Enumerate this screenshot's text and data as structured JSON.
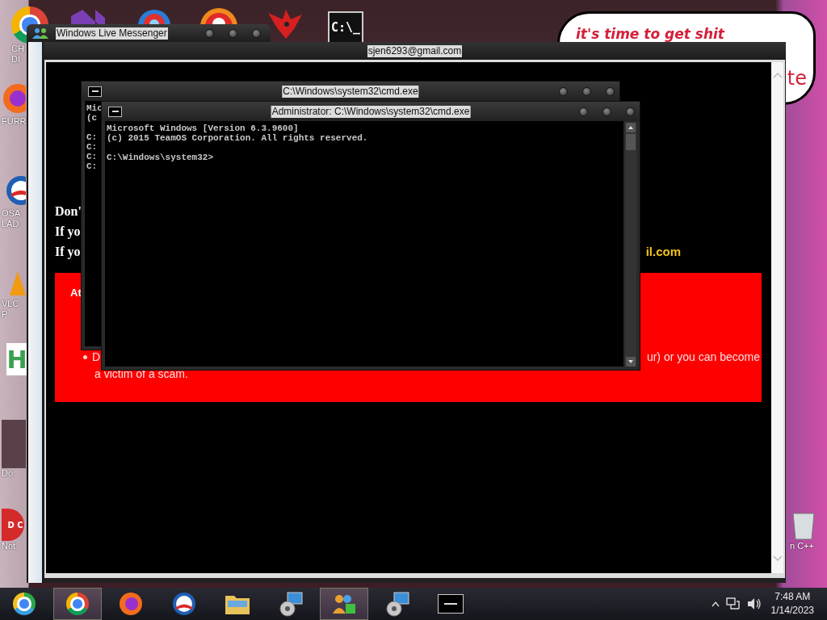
{
  "desktop": {
    "icons": [
      {
        "kind": "chrome",
        "label": [
          "CH",
          "DI"
        ]
      },
      {
        "kind": "ribbon"
      },
      {
        "kind": "ring"
      },
      {
        "kind": "disc"
      },
      {
        "kind": "bird"
      },
      {
        "kind": "terminal",
        "text": "C:\\_"
      },
      {
        "kind": "globe",
        "label": [
          "FURR"
        ]
      },
      {
        "kind": "sunrise",
        "label": [
          "OSA",
          "LAD"
        ]
      },
      {
        "kind": "cone",
        "label": [
          "VLC",
          "P"
        ]
      },
      {
        "kind": "letter",
        "text": "H"
      },
      {
        "kind": "photo",
        "label": [
          "Do"
        ]
      },
      {
        "kind": "badge",
        "text": "D C",
        "label": [
          "Not"
        ]
      },
      {
        "kind": "bin",
        "label": [
          "n C++"
        ]
      }
    ],
    "bubble": {
      "lines": [
        "it's time to get shit",
        "te"
      ]
    }
  },
  "messenger": {
    "title": "Windows Live Messenger",
    "account": "sjen6293@gmail.com",
    "lines": [
      {
        "left": "Don'"
      },
      {
        "left": "If yo"
      },
      {
        "left": "If yo",
        "right": "il.com"
      }
    ],
    "alert": {
      "heading": "At",
      "bullet_start": "D",
      "bullet_end": "ur) or you can become",
      "continuation": "a victim of a scam."
    }
  },
  "cmd_back": {
    "title": "C:\\Windows\\system32\\cmd.exe",
    "blocks": [
      [
        "Mic",
        "(c"
      ],
      [
        "C:",
        "C:",
        "C:",
        "C:"
      ]
    ]
  },
  "cmd_front": {
    "title": "Administrator: C:\\Windows\\system32\\cmd.exe",
    "blocks": [
      [
        "Microsoft Windows [Version 6.3.9600]",
        "(c) 2015 TeamOS Corporation. All rights reserved."
      ],
      [
        "C:\\Windows\\system32>"
      ]
    ]
  },
  "taskbar": {
    "items": [
      {
        "kind": "chrome-alt",
        "active": false
      },
      {
        "kind": "chrome",
        "active": true
      },
      {
        "kind": "globe",
        "active": false
      },
      {
        "kind": "sunrise",
        "active": false
      },
      {
        "kind": "folder",
        "active": false
      },
      {
        "kind": "installer",
        "active": false
      },
      {
        "kind": "people",
        "active": true
      },
      {
        "kind": "installer",
        "active": false
      },
      {
        "kind": "terminal",
        "active": false
      }
    ],
    "time": "7:48 AM",
    "date": "1/14/2023"
  }
}
